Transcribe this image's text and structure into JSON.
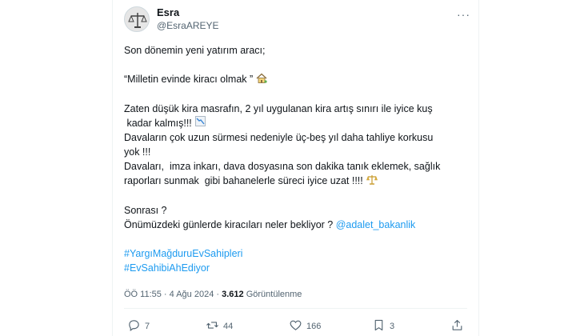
{
  "author": {
    "name": "Esra",
    "handle": "@EsraAREYE"
  },
  "more_label": "···",
  "tweet": {
    "line1": "Son dönemin yeni yatırım aracı;",
    "line2": "“Milletin evinde kiracı olmak ”",
    "line3a": "Zaten düşük kira masrafın, 2 yıl uygulanan kira artış sınırı ile iyice kuş",
    "line3b": " kadar kalmış!!!",
    "line4a": "Davaların çok uzun sürmesi nedeniyle üç-beş yıl daha tahliye korkusu",
    "line4b": "yok !!!",
    "line5a": "Davaları,  imza inkarı, dava dosyasına son dakika tanık eklemek, sağlık",
    "line5b": "raporları sunmak  gibi bahanelerle süreci iyice uzat !!!!",
    "line6": "Sonrası ?",
    "line7_text": "Önümüzdeki günlerde kiracıları neler bekliyor ? ",
    "line7_mention": "@adalet_bakanlik",
    "hashtag1": "#YargıMağduruEvSahipleri",
    "hashtag2": "#EvSahibiAhEdiyor"
  },
  "meta": {
    "time": "ÖÖ 11:55 · 4 Ağu 2024 · ",
    "views": "3.612",
    "views_label": " Görüntülenme"
  },
  "actions": {
    "replies": "7",
    "reposts": "44",
    "likes": "166",
    "bookmarks": "3"
  },
  "icons": {
    "house": "house-with-garden-icon",
    "chart": "chart-decreasing-icon",
    "scales": "balance-scale-icon"
  },
  "colors": {
    "link": "#1d9bf0",
    "muted": "#536471",
    "text": "#0f1419"
  }
}
